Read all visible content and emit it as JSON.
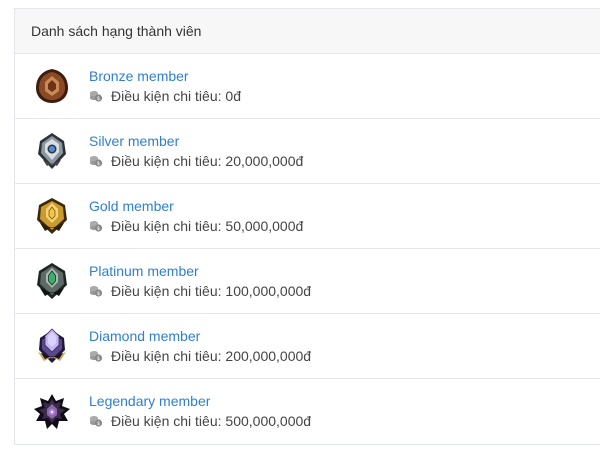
{
  "panel": {
    "title": "Danh sách hạng thành viên"
  },
  "tiers": [
    {
      "name": "Bronze member",
      "condition_label": "Điều kiện chi tiêu:",
      "amount": "0đ",
      "badge_icon": "bronze-badge-icon",
      "colors": {
        "main": "#8a4a25",
        "light": "#c98a55",
        "dark": "#3e1d0c"
      }
    },
    {
      "name": "Silver member",
      "condition_label": "Điều kiện chi tiêu:",
      "amount": "20,000,000đ",
      "badge_icon": "silver-badge-icon",
      "colors": {
        "main": "#8e98a3",
        "light": "#d8dee4",
        "dark": "#2f3338",
        "gem": "#4a8fd8"
      }
    },
    {
      "name": "Gold member",
      "condition_label": "Điều kiện chi tiêu:",
      "amount": "50,000,000đ",
      "badge_icon": "gold-badge-icon",
      "colors": {
        "main": "#c99a2e",
        "light": "#f2d37a",
        "dark": "#3b2a0a",
        "gem": "#f5c542"
      }
    },
    {
      "name": "Platinum member",
      "condition_label": "Điều kiện chi tiêu:",
      "amount": "100,000,000đ",
      "badge_icon": "platinum-badge-icon",
      "colors": {
        "main": "#5d6a66",
        "light": "#a9b8b2",
        "dark": "#1f2523",
        "gem": "#3fae6b"
      }
    },
    {
      "name": "Diamond member",
      "condition_label": "Điều kiện chi tiêu:",
      "amount": "200,000,000đ",
      "badge_icon": "diamond-badge-icon",
      "colors": {
        "main": "#5b4a8a",
        "light": "#c7b6f0",
        "dark": "#22183a",
        "gem": "#d9d2ff"
      }
    },
    {
      "name": "Legendary member",
      "condition_label": "Điều kiện chi tiêu:",
      "amount": "500,000,000đ",
      "badge_icon": "legendary-badge-icon",
      "colors": {
        "main": "#3b2b4a",
        "light": "#8a6aa6",
        "dark": "#120c18",
        "gem": "#b07ad8"
      }
    }
  ],
  "accent_color": "#2e7fcf",
  "coin_icon": "coins-icon"
}
